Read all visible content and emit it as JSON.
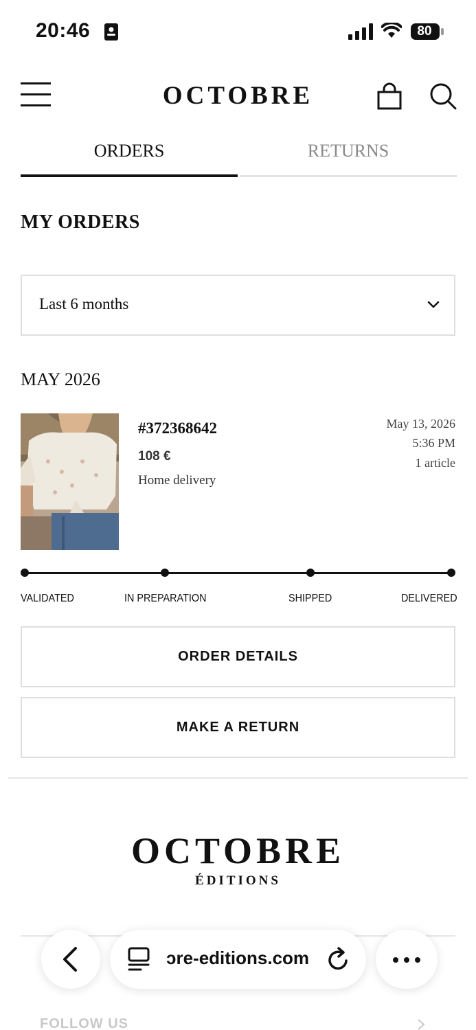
{
  "status_bar": {
    "time": "20:46",
    "battery": "80"
  },
  "header": {
    "logo": "OCTOBRE"
  },
  "tabs": [
    {
      "label": "ORDERS",
      "active": true
    },
    {
      "label": "RETURNS",
      "active": false
    }
  ],
  "section_title": "MY ORDERS",
  "period_select": {
    "value": "Last 6 months"
  },
  "month_group": "MAY 2026",
  "order": {
    "number": "#372368642",
    "price": "108 €",
    "delivery": "Home delivery",
    "date": "May 13, 2026",
    "time": "5:36 PM",
    "count": "1 article",
    "progress_steps": [
      "VALIDATED",
      "IN PREPARATION",
      "SHIPPED",
      "DELIVERED"
    ],
    "progress_completed": 4
  },
  "buttons": {
    "order_details": "ORDER DETAILS",
    "make_return": "MAKE A RETURN"
  },
  "footer": {
    "logo": "OCTOBRE",
    "subtitle": "ÉDITIONS",
    "follow": "FOLLOW US"
  },
  "browser_bar": {
    "url": "ɔre-editions.com"
  },
  "colors": {
    "text": "#111111",
    "muted": "#8a8a8a",
    "border": "#dedede"
  }
}
